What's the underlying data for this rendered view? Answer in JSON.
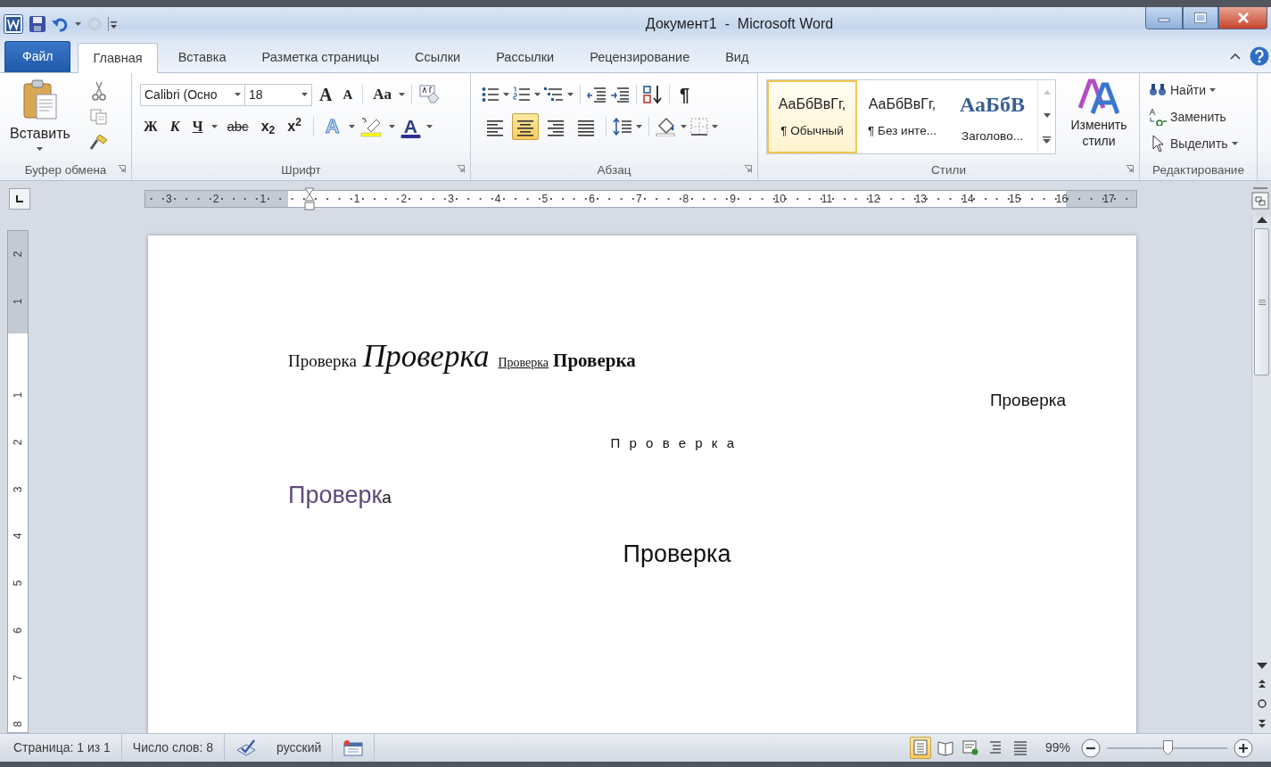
{
  "window": {
    "title": "Документ1  -  Microsoft Word"
  },
  "tabs": [
    {
      "label": "Файл",
      "kind": "file",
      "selected": false
    },
    {
      "label": "Главная",
      "kind": "tab",
      "selected": true
    },
    {
      "label": "Вставка",
      "kind": "tab",
      "selected": false
    },
    {
      "label": "Разметка страницы",
      "kind": "tab",
      "selected": false
    },
    {
      "label": "Ссылки",
      "kind": "tab",
      "selected": false
    },
    {
      "label": "Рассылки",
      "kind": "tab",
      "selected": false
    },
    {
      "label": "Рецензирование",
      "kind": "tab",
      "selected": false
    },
    {
      "label": "Вид",
      "kind": "tab",
      "selected": false
    }
  ],
  "ribbon": {
    "clipboard": {
      "label": "Буфер обмена",
      "paste": "Вставить"
    },
    "font": {
      "label": "Шрифт",
      "font_name": "Calibri (Осно",
      "font_size": "18",
      "grow": "A",
      "shrink": "A",
      "change_case": "Aa",
      "format_buttons": [
        {
          "text": "Ж",
          "kind": "bold"
        },
        {
          "text": "К",
          "kind": "italic"
        },
        {
          "text": "Ч",
          "kind": "underline"
        },
        {
          "text": "abc",
          "kind": "strike"
        },
        {
          "text": "x$_{2}$",
          "kind": "sub"
        },
        {
          "text": "x$^{2}$",
          "kind": "sup"
        }
      ],
      "effects": "A",
      "font_color": "A"
    },
    "paragraph": {
      "label": "Абзац",
      "show_marks": "¶",
      "align_buttons": [
        {
          "kind": "left",
          "selected": false
        },
        {
          "kind": "center",
          "selected": true
        },
        {
          "kind": "right",
          "selected": false
        },
        {
          "kind": "justify",
          "selected": false
        }
      ]
    },
    "styles": {
      "label": "Стили",
      "change": "Изменить стили",
      "gallery": [
        {
          "sample": "АаБбВвГг,",
          "name": "¶ Обычный",
          "kind": "normal",
          "selected": true
        },
        {
          "sample": "АаБбВвГг,",
          "name": "¶ Без инте...",
          "kind": "normal",
          "selected": false
        },
        {
          "sample": "АаБбВ",
          "name": "Заголово...",
          "kind": "heading",
          "selected": false
        }
      ]
    },
    "editing": {
      "label": "Редактирование",
      "commands": [
        {
          "label": "Найти",
          "kind": "find",
          "dropdown": true
        },
        {
          "label": "Заменить",
          "kind": "replace",
          "dropdown": false
        },
        {
          "label": "Выделить",
          "kind": "select",
          "dropdown": true
        }
      ]
    }
  },
  "ruler": {
    "left_labels": [
      "3",
      "2",
      "1"
    ],
    "right_labels": [
      "1",
      "2",
      "3",
      "4",
      "5",
      "6",
      "7",
      "8",
      "9",
      "10",
      "11",
      "12",
      "13",
      "14",
      "15",
      "16",
      "17"
    ]
  },
  "vertical_ruler": {
    "top_labels": [
      "2",
      "1"
    ],
    "labels": [
      "1",
      "2",
      "3",
      "4",
      "5",
      "6",
      "7",
      "8"
    ]
  },
  "document": {
    "paragraphs": [
      {
        "kind": "left-aligned",
        "runs": [
          {
            "text": "Проверка",
            "kind": "serif"
          },
          {
            "text": "Проверка",
            "kind": "serif-italic-large"
          },
          {
            "text": "Проверка",
            "kind": "serif-small-underline"
          },
          {
            "text": "Проверка",
            "kind": "serif-bold"
          }
        ]
      },
      {
        "kind": "right-aligned",
        "runs": [
          {
            "text": "Проверка",
            "kind": "sans"
          }
        ]
      },
      {
        "kind": "centered",
        "runs": [
          {
            "text": "Проверка",
            "kind": "sans-spaced"
          }
        ]
      },
      {
        "kind": "left-aligned",
        "runs": [
          {
            "text": "Проверк",
            "kind": "sans-large-purple"
          },
          {
            "text": "а",
            "kind": "sans"
          }
        ]
      },
      {
        "kind": "centered",
        "runs": [
          {
            "text": "Проверка",
            "kind": "sans-large"
          }
        ]
      }
    ]
  },
  "status_bar": {
    "page": "Страница: 1 из 1",
    "words": "Число слов: 8",
    "language": "русский",
    "views": [
      {
        "kind": "print",
        "selected": true
      },
      {
        "kind": "reading",
        "selected": false
      },
      {
        "kind": "web",
        "selected": false
      },
      {
        "kind": "outline",
        "selected": false
      },
      {
        "kind": "draft",
        "selected": false
      }
    ],
    "zoom": {
      "label": "99%",
      "level": 0.5
    }
  }
}
